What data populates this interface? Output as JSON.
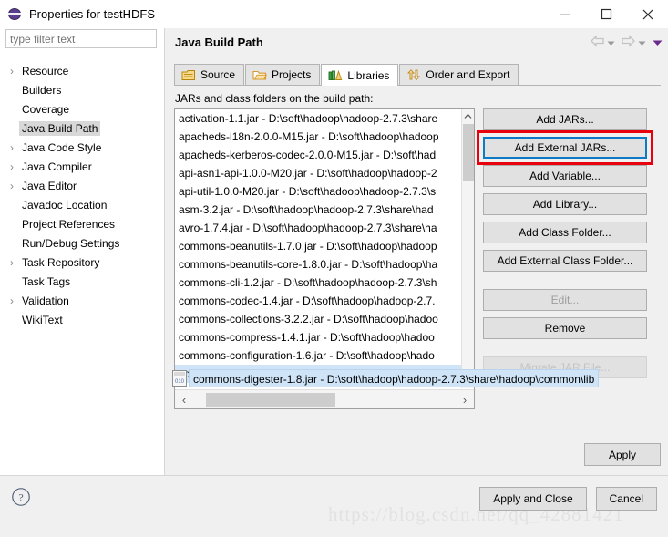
{
  "window": {
    "title": "Properties for testHDFS",
    "icon": "eclipse-icon",
    "minimize": "—",
    "maximize": "□",
    "close": "✕"
  },
  "filter": {
    "placeholder": "type filter text",
    "value": ""
  },
  "header": {
    "title": "Java Build Path",
    "nav": {
      "back": "back-arrow",
      "back_menu": "chevron-down",
      "forward": "forward-arrow",
      "forward_menu": "chevron-down",
      "view_menu": "chevron-down-purple"
    }
  },
  "sidebar": {
    "items": [
      {
        "label": "Resource",
        "expandable": true,
        "selected": false
      },
      {
        "label": "Builders",
        "expandable": false,
        "selected": false
      },
      {
        "label": "Coverage",
        "expandable": false,
        "selected": false
      },
      {
        "label": "Java Build Path",
        "expandable": false,
        "selected": true
      },
      {
        "label": "Java Code Style",
        "expandable": true,
        "selected": false
      },
      {
        "label": "Java Compiler",
        "expandable": true,
        "selected": false
      },
      {
        "label": "Java Editor",
        "expandable": true,
        "selected": false
      },
      {
        "label": "Javadoc Location",
        "expandable": false,
        "selected": false
      },
      {
        "label": "Project References",
        "expandable": false,
        "selected": false
      },
      {
        "label": "Run/Debug Settings",
        "expandable": false,
        "selected": false
      },
      {
        "label": "Task Repository",
        "expandable": true,
        "selected": false
      },
      {
        "label": "Task Tags",
        "expandable": false,
        "selected": false
      },
      {
        "label": "Validation",
        "expandable": true,
        "selected": false
      },
      {
        "label": "WikiText",
        "expandable": false,
        "selected": false
      }
    ]
  },
  "tabs": [
    {
      "label": "Source",
      "icon": "package-icon",
      "active": false
    },
    {
      "label": "Projects",
      "icon": "folder-icon",
      "active": false
    },
    {
      "label": "Libraries",
      "icon": "books-icon",
      "active": true
    },
    {
      "label": "Order and Export",
      "icon": "order-arrows-icon",
      "active": false
    }
  ],
  "list": {
    "caption": "JARs and class folders on the build path:",
    "rows": [
      {
        "text": "activation-1.1.jar - D:\\soft\\hadoop\\hadoop-2.7.3\\share",
        "selected": false
      },
      {
        "text": "apacheds-i18n-2.0.0-M15.jar - D:\\soft\\hadoop\\hadoop",
        "selected": false
      },
      {
        "text": "apacheds-kerberos-codec-2.0.0-M15.jar - D:\\soft\\had",
        "selected": false
      },
      {
        "text": "api-asn1-api-1.0.0-M20.jar - D:\\soft\\hadoop\\hadoop-2",
        "selected": false
      },
      {
        "text": "api-util-1.0.0-M20.jar - D:\\soft\\hadoop\\hadoop-2.7.3\\s",
        "selected": false
      },
      {
        "text": "asm-3.2.jar - D:\\soft\\hadoop\\hadoop-2.7.3\\share\\had",
        "selected": false
      },
      {
        "text": "avro-1.7.4.jar - D:\\soft\\hadoop\\hadoop-2.7.3\\share\\ha",
        "selected": false
      },
      {
        "text": "commons-beanutils-1.7.0.jar - D:\\soft\\hadoop\\hadoop",
        "selected": false
      },
      {
        "text": "commons-beanutils-core-1.8.0.jar - D:\\soft\\hadoop\\ha",
        "selected": false
      },
      {
        "text": "commons-cli-1.2.jar - D:\\soft\\hadoop\\hadoop-2.7.3\\sh",
        "selected": false
      },
      {
        "text": "commons-codec-1.4.jar - D:\\soft\\hadoop\\hadoop-2.7.",
        "selected": false
      },
      {
        "text": "commons-collections-3.2.2.jar - D:\\soft\\hadoop\\hadoo",
        "selected": false
      },
      {
        "text": "commons-compress-1.4.1.jar - D:\\soft\\hadoop\\hadoo",
        "selected": false
      },
      {
        "text": "commons-configuration-1.6.jar - D:\\soft\\hadoop\\hado",
        "selected": false
      },
      {
        "text": "commons-digester-1.8.jar - D:\\soft\\hadoop\\hadoop-2.7.3",
        "selected": true
      }
    ],
    "drag_row": {
      "text": "commons-digester-1.8.jar - D:\\soft\\hadoop\\hadoop-2.7.3\\share\\hadoop\\common\\lib",
      "icon": "jar-file-icon"
    },
    "scroll": {
      "up_arrow": "∧",
      "left_arrow": "‹",
      "right_arrow": "›"
    }
  },
  "buttons": {
    "add_jars": "Add JARs...",
    "add_external_jars": "Add External JARs...",
    "add_variable": "Add Variable...",
    "add_library": "Add Library...",
    "add_class_folder": "Add Class Folder...",
    "add_external_class_folder": "Add External Class Folder...",
    "edit": "Edit...",
    "remove": "Remove",
    "migrate_jar_file": "Migrate JAR File...",
    "apply": "Apply"
  },
  "footer": {
    "help": "?",
    "apply_and_close": "Apply and Close",
    "cancel": "Cancel",
    "watermark": "https://blog.csdn.net/qq_42881421"
  },
  "colors": {
    "focus_blue": "#0d7ac4",
    "annotation_red": "#e8000d",
    "selection_blue": "#cfe4f7",
    "panel_gray": "#f0f0f0"
  }
}
